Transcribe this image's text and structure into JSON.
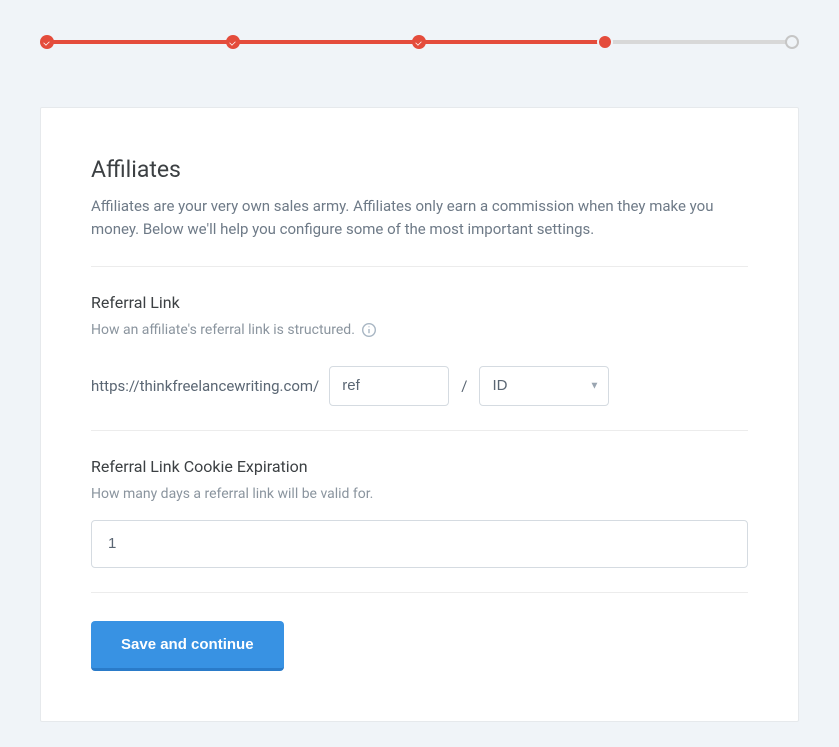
{
  "stepper": {
    "total": 5,
    "current": 4,
    "states": [
      "completed",
      "completed",
      "completed",
      "current",
      "pending"
    ]
  },
  "card": {
    "title": "Affiliates",
    "description": "Affiliates are your very own sales army. Affiliates only earn a commission when they make you money. Below we'll help you configure some of the most important settings."
  },
  "referral_link": {
    "title": "Referral Link",
    "description": "How an affiliate's referral link is structured.",
    "url_prefix": "https://thinkfreelancewriting.com/",
    "ref_value": "ref",
    "separator": "/",
    "id_value": "ID"
  },
  "cookie_expiration": {
    "title": "Referral Link Cookie Expiration",
    "description": "How many days a referral link will be valid for.",
    "value": "1"
  },
  "actions": {
    "save_label": "Save and continue"
  },
  "colors": {
    "accent_red": "#e44c3c",
    "accent_blue": "#3892e3",
    "bg": "#f0f4f8"
  }
}
